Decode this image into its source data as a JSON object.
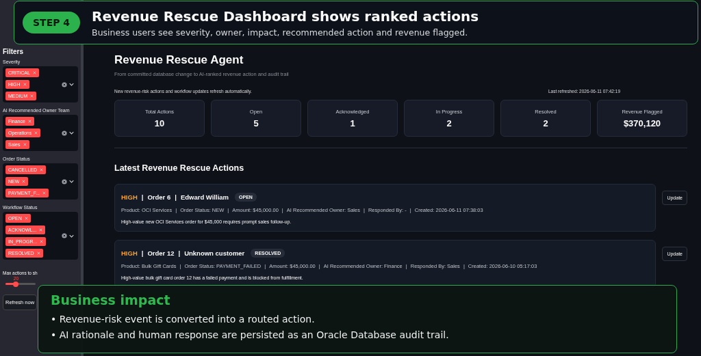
{
  "banner": {
    "step": "STEP 4",
    "title": "Revenue Rescue Dashboard shows ranked actions",
    "subtitle": "Business users see severity, owner, impact, recommended action and revenue flagged."
  },
  "sidebar": {
    "title": "Filters",
    "filters": [
      {
        "label": "Severity",
        "tags": [
          "CRITICAL",
          "HIGH",
          "MEDIUM"
        ]
      },
      {
        "label": "AI Recommended Owner Team",
        "tags": [
          "Finance",
          "Operations",
          "Sales"
        ]
      },
      {
        "label": "Order Status",
        "tags": [
          "CANCELLED",
          "NEW",
          "PAYMENT_F..."
        ]
      },
      {
        "label": "Workflow Status",
        "tags": [
          "OPEN",
          "ACKNOWL...",
          "IN_PROGR...",
          "RESOLVED"
        ]
      }
    ],
    "slider": {
      "label": "Max actions to sh",
      "value": "20",
      "level": 0.35
    },
    "refresh_button": "Refresh now"
  },
  "main": {
    "title": "Revenue Rescue Agent",
    "subtitle": "From committed database change to AI-ranked revenue action and audit trail",
    "note": "New revenue-risk actions and workflow updates refresh automatically.",
    "last_refreshed": "Last refreshed: 2026-06-11 07:42:19",
    "metrics": [
      {
        "label": "Total Actions",
        "value": "10"
      },
      {
        "label": "Open",
        "value": "5"
      },
      {
        "label": "Acknowledged",
        "value": "1"
      },
      {
        "label": "In Progress",
        "value": "2"
      },
      {
        "label": "Resolved",
        "value": "2"
      },
      {
        "label": "Revenue Flagged",
        "value": "$370,120"
      }
    ],
    "section_title": "Latest Revenue Rescue Actions",
    "separator": "|",
    "actions": [
      {
        "severity": "HIGH",
        "color": "#f5a030",
        "order": "Order 6",
        "customer": "Edward William",
        "status": "OPEN",
        "meta": [
          "Product: OCI Services",
          "Order Status: NEW",
          "Amount: $45,000.00",
          "AI Recommended Owner: Sales",
          "Responded By: -",
          "Created: 2026-06-11 07:38:03"
        ],
        "summary": "High-value new OCI Services order for $45,000 requires prompt sales follow-up.",
        "button": "Update"
      },
      {
        "severity": "HIGH",
        "color": "#f5a030",
        "order": "Order 12",
        "customer": "Unknown customer",
        "status": "RESOLVED",
        "meta": [
          "Product: Bulk Gift Cards",
          "Order Status: PAYMENT_FAILED",
          "Amount: $45,000.00",
          "AI Recommended Owner: Finance",
          "Responded By: Sales",
          "Created: 2026-06-10 05:17:03"
        ],
        "summary": "High-value bulk gift card order 12 has a failed payment and is blocked from fulfillment.",
        "button": "Update"
      }
    ]
  },
  "impact": {
    "title": "Business impact",
    "bullet_mark": "•",
    "bullets": [
      "Revenue-risk event is converted into a routed action.",
      "AI rationale and human response are persisted as an Oracle Database audit trail."
    ]
  }
}
